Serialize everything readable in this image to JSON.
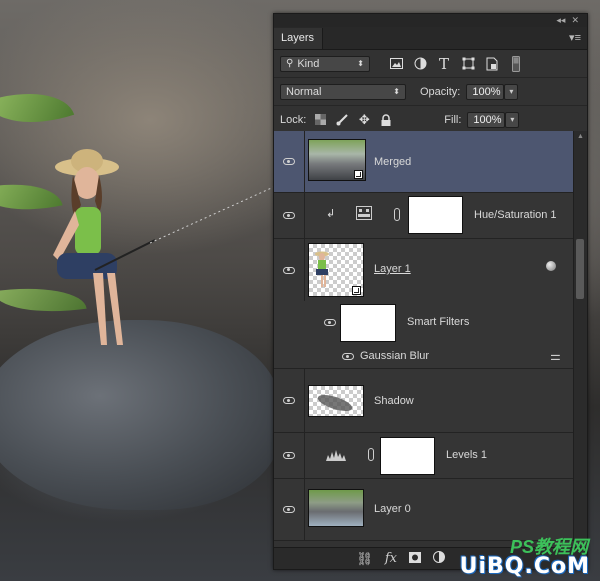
{
  "panel": {
    "tab_label": "Layers",
    "menu_icon": "panel-menu-icon",
    "topbar_icons": [
      "collapse-icon",
      "close-icon"
    ]
  },
  "filter": {
    "kind_label": "Kind",
    "filter_icons": [
      "image-filter-icon",
      "adjustment-filter-icon",
      "type-filter-icon",
      "shape-filter-icon",
      "smart-object-filter-icon",
      "toggle-filter-icon"
    ]
  },
  "blend": {
    "mode": "Normal",
    "opacity_label": "Opacity:",
    "opacity_value": "100%"
  },
  "lock": {
    "label": "Lock:",
    "fill_label": "Fill:",
    "fill_value": "100%"
  },
  "layers": [
    {
      "name": "Merged",
      "selected": true,
      "type": "smart-object"
    },
    {
      "name": "Hue/Saturation 1",
      "type": "adjustment-clipped"
    },
    {
      "name": "Layer 1",
      "type": "smart-object"
    },
    {
      "name": "Smart Filters",
      "type": "smart-filter-mask"
    },
    {
      "name": "Gaussian Blur",
      "type": "filter-entry"
    },
    {
      "name": "Shadow",
      "type": "pixel"
    },
    {
      "name": "Levels 1",
      "type": "adjustment"
    },
    {
      "name": "Layer 0",
      "type": "smart-object"
    }
  ],
  "bottom_icons": [
    "link-layers-icon",
    "fx-icon",
    "add-mask-icon",
    "new-adjustment-icon"
  ],
  "watermark": {
    "text": "UiBQ.CoM",
    "text2": "PS教程网"
  },
  "colors": {
    "panel_bg": "#323232",
    "selected_row": "#4d5670"
  }
}
